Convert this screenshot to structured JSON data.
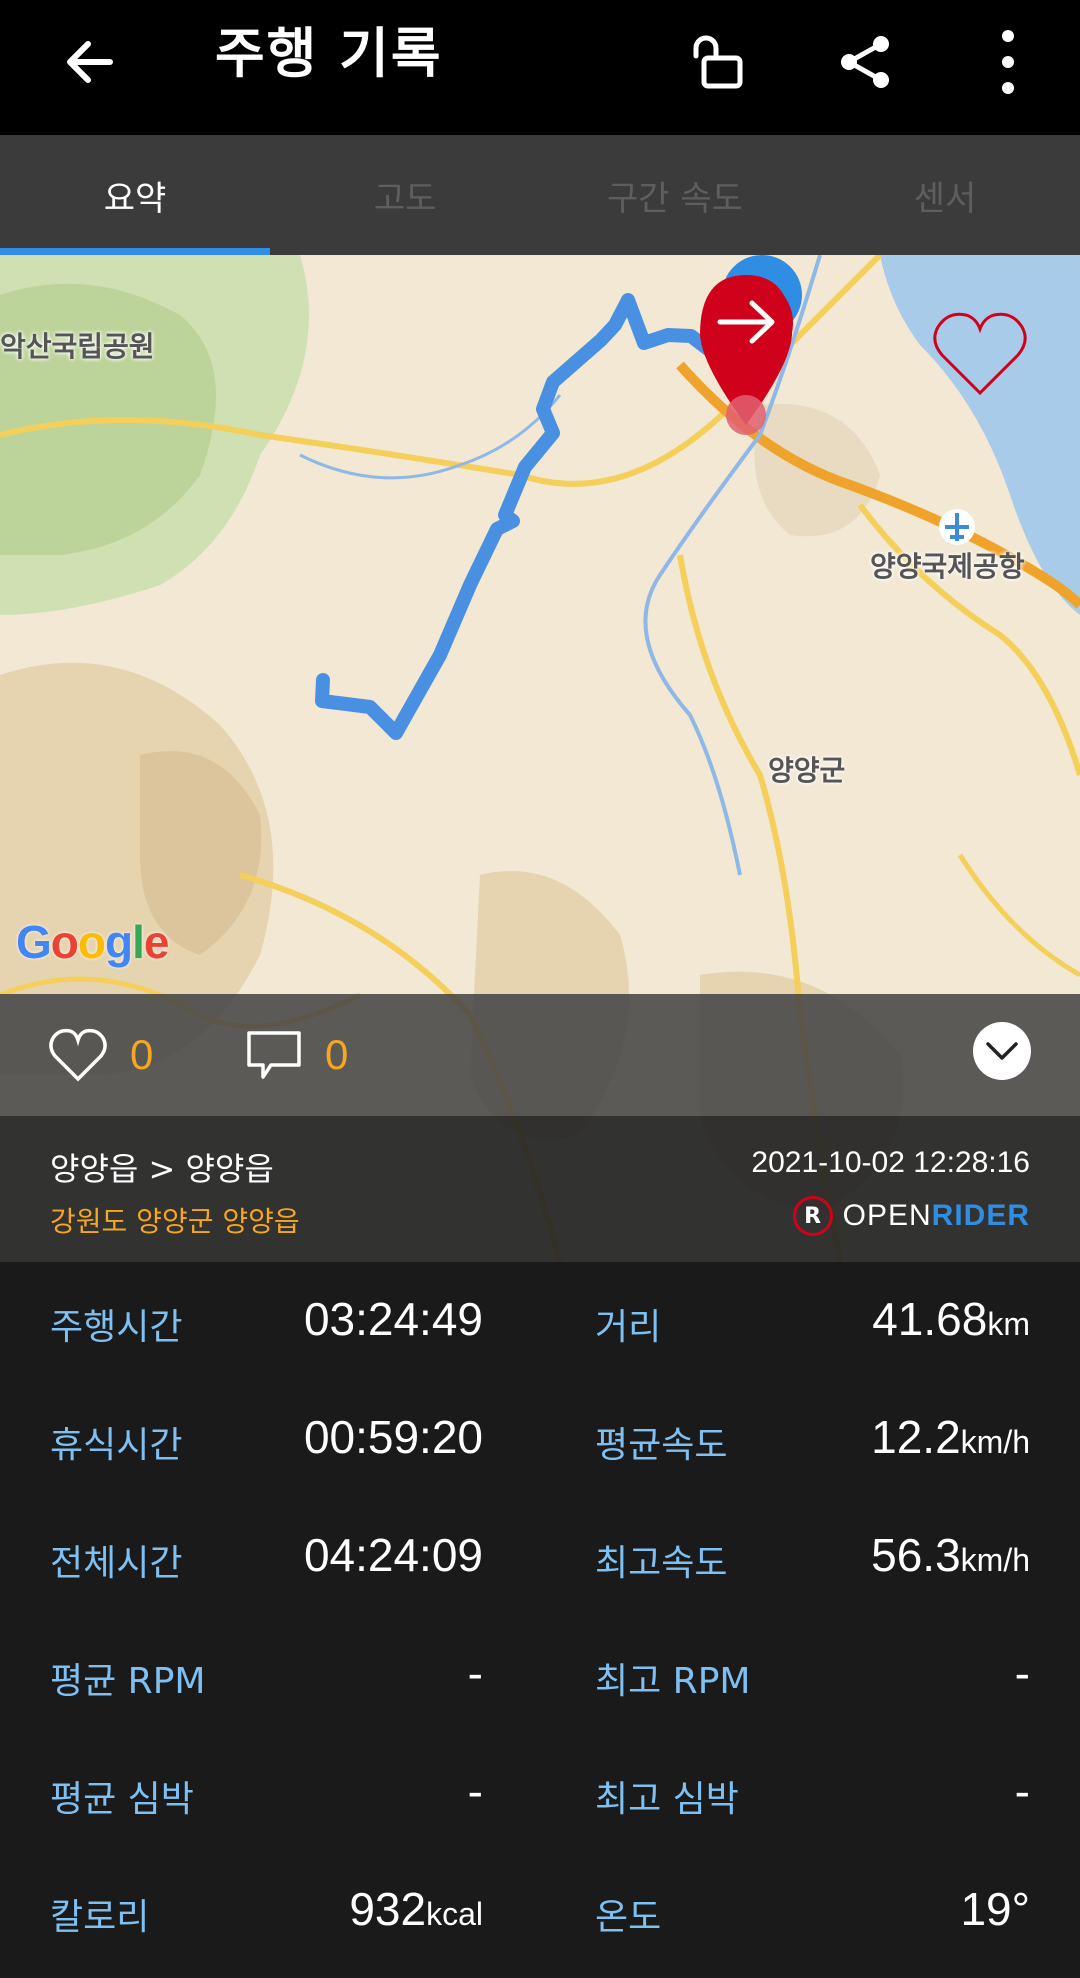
{
  "header": {
    "title": "주행 기록",
    "back_icon": "arrow-left-icon",
    "lock_icon": "unlock-icon",
    "share_icon": "share-icon",
    "more_icon": "more-vertical-icon"
  },
  "tabs": [
    {
      "label": "요약",
      "active": true
    },
    {
      "label": "고도",
      "active": false
    },
    {
      "label": "구간 속도",
      "active": false
    },
    {
      "label": "센서",
      "active": false
    }
  ],
  "map": {
    "labels": {
      "park": "악산국립공원",
      "airport": "양양국제공항",
      "county": "양양군"
    },
    "attribution": "Google",
    "route_color": "#4a90e2",
    "marker_color": "#d0021b"
  },
  "social": {
    "likes": "0",
    "comments": "0"
  },
  "route": {
    "path": "양양읍 > 양양읍",
    "region": "강원도 양양군 양양읍",
    "datetime": "2021-10-02 12:28:16",
    "brand_open": "OPEN",
    "brand_rider": "RIDER",
    "brand_logo_letter": "R"
  },
  "stats": {
    "ride_time_label": "주행시간",
    "ride_time": "03:24:49",
    "distance_label": "거리",
    "distance": "41.68",
    "distance_unit": "km",
    "rest_time_label": "휴식시간",
    "rest_time": "00:59:20",
    "avg_speed_label": "평균속도",
    "avg_speed": "12.2",
    "avg_speed_unit": "km/h",
    "total_time_label": "전체시간",
    "total_time": "04:24:09",
    "max_speed_label": "최고속도",
    "max_speed": "56.3",
    "max_speed_unit": "km/h",
    "avg_rpm_label": "평균 RPM",
    "avg_rpm": "-",
    "max_rpm_label": "최고 RPM",
    "max_rpm": "-",
    "avg_hr_label": "평균 심박",
    "avg_hr": "-",
    "max_hr_label": "최고 심박",
    "max_hr": "-",
    "calories_label": "칼로리",
    "calories": "932",
    "calories_unit": "kcal",
    "temp_label": "온도",
    "temp": "19°"
  }
}
